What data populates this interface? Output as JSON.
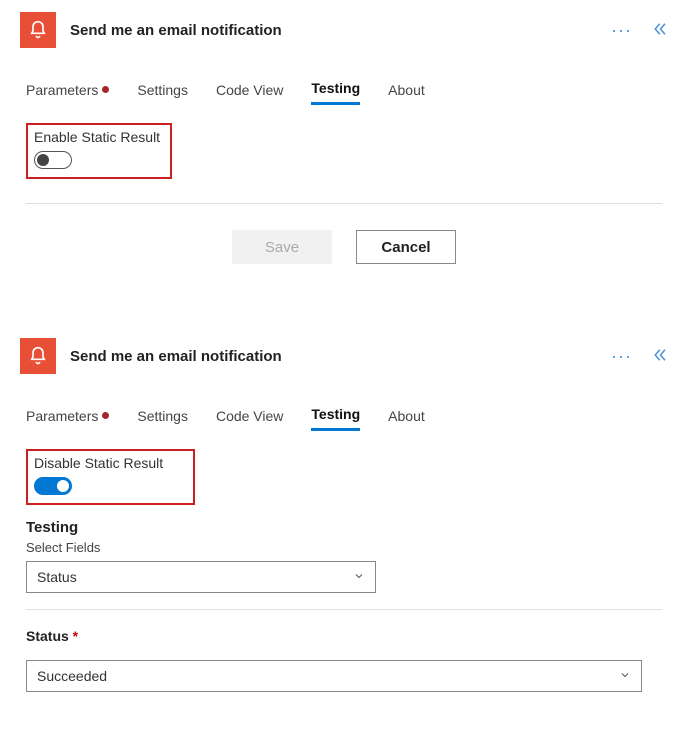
{
  "panel1": {
    "title": "Send me an email notification",
    "tabs": [
      {
        "label": "Parameters",
        "badge": true
      },
      {
        "label": "Settings"
      },
      {
        "label": "Code View"
      },
      {
        "label": "Testing",
        "active": true
      },
      {
        "label": "About"
      }
    ],
    "toggle_label": "Enable Static Result",
    "toggle_on": false,
    "save_label": "Save",
    "cancel_label": "Cancel"
  },
  "panel2": {
    "title": "Send me an email notification",
    "tabs": [
      {
        "label": "Parameters",
        "badge": true
      },
      {
        "label": "Settings"
      },
      {
        "label": "Code View"
      },
      {
        "label": "Testing",
        "active": true
      },
      {
        "label": "About"
      }
    ],
    "toggle_label": "Disable Static Result",
    "toggle_on": true,
    "section_title": "Testing",
    "select_fields_label": "Select Fields",
    "select_fields_value": "Status",
    "status_label": "Status",
    "status_value": "Succeeded"
  }
}
